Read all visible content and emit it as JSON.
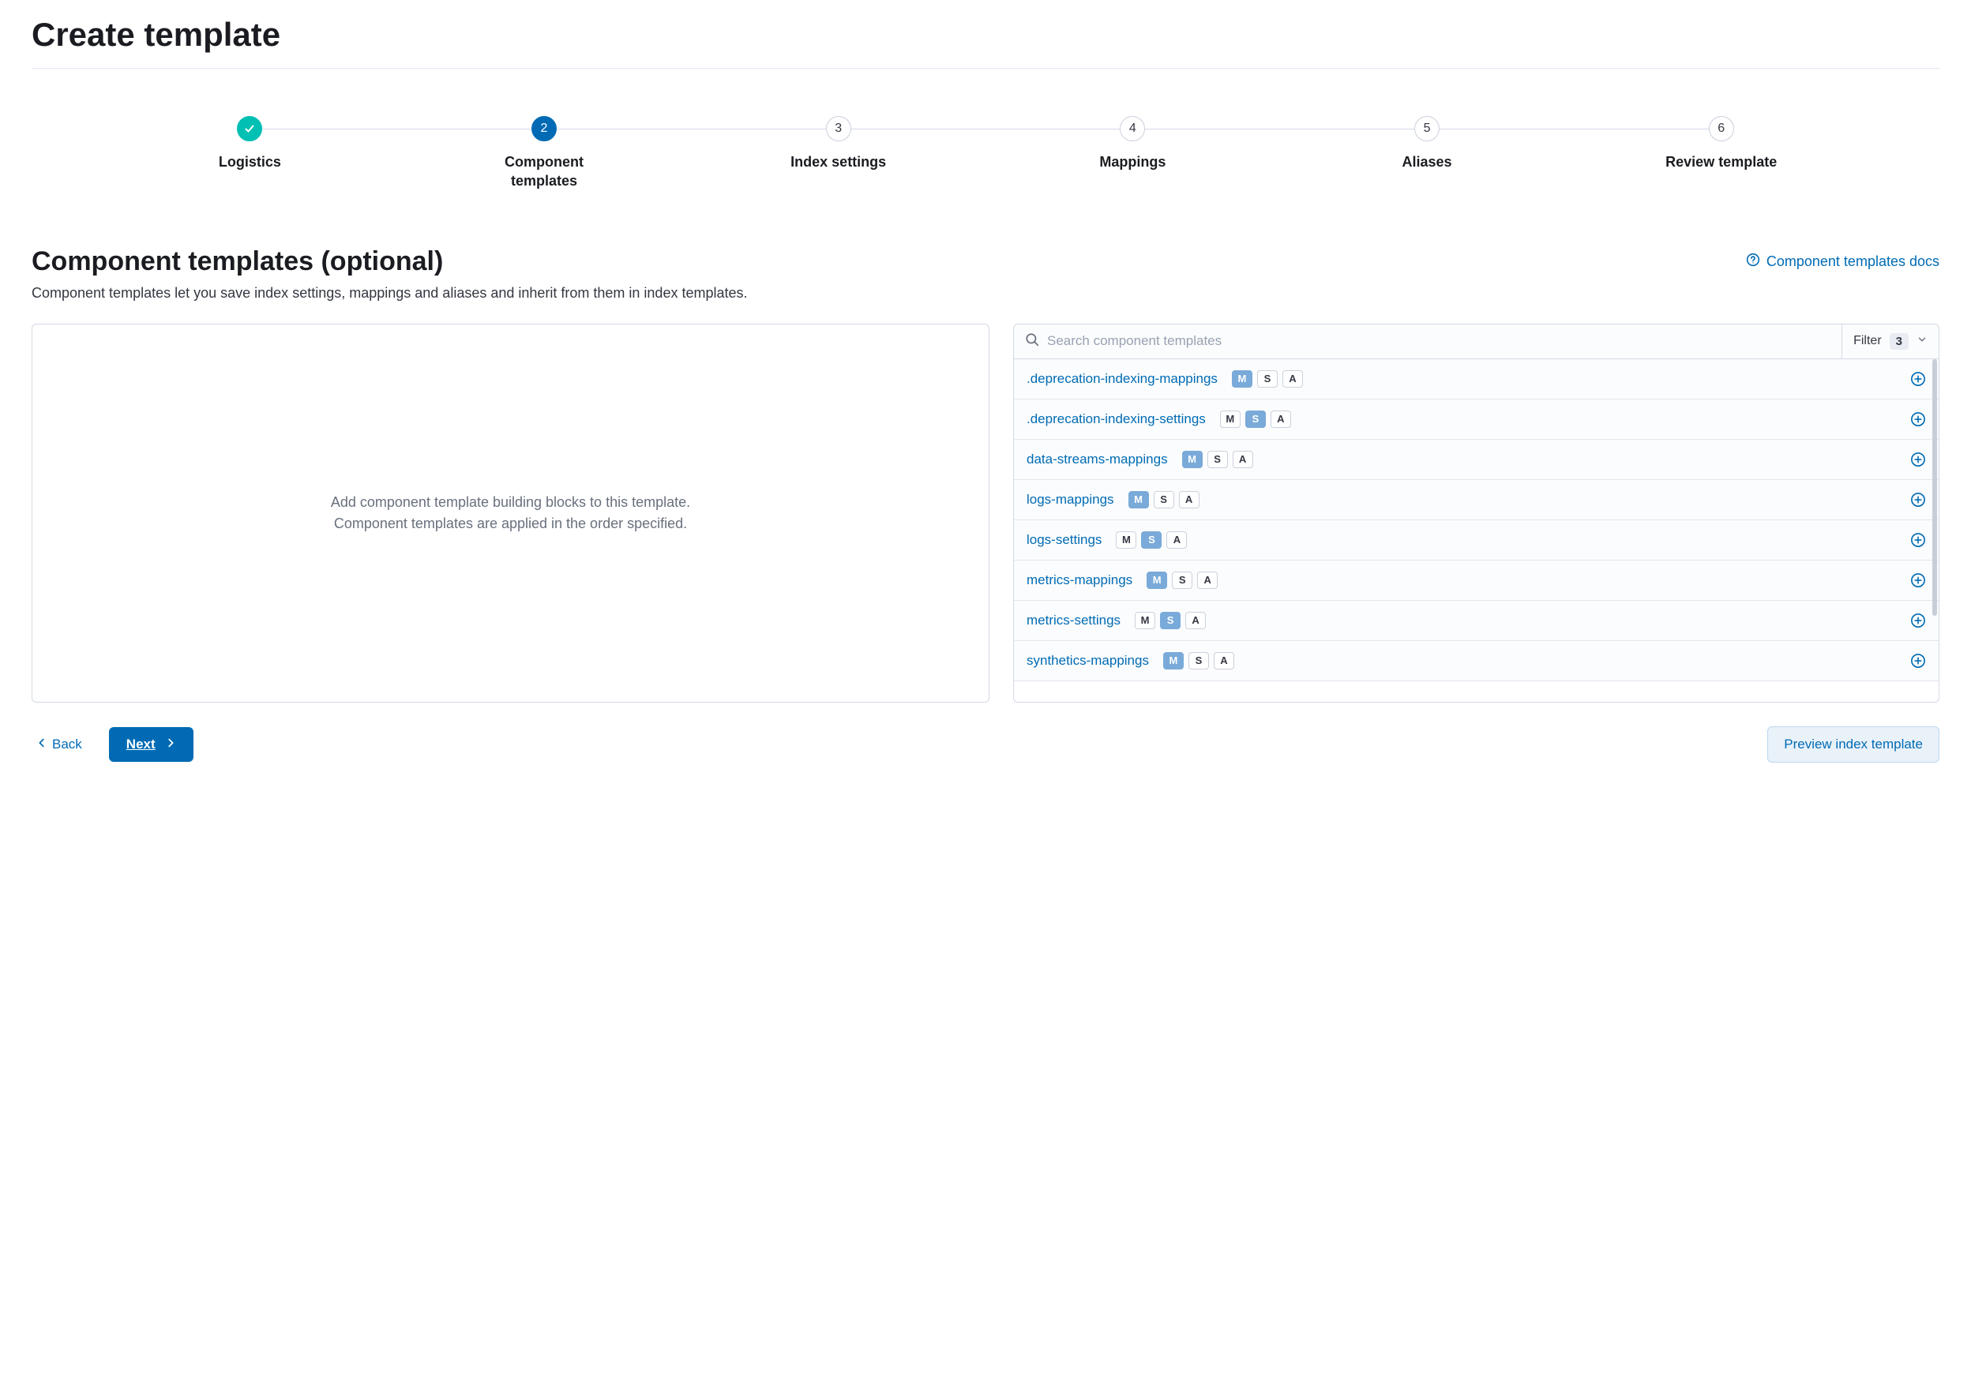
{
  "page_title": "Create template",
  "steps": [
    {
      "label": "Logistics",
      "state": "complete"
    },
    {
      "label": "Component templates",
      "state": "current",
      "num": "2"
    },
    {
      "label": "Index settings",
      "state": "pending",
      "num": "3"
    },
    {
      "label": "Mappings",
      "state": "pending",
      "num": "4"
    },
    {
      "label": "Aliases",
      "state": "pending",
      "num": "5"
    },
    {
      "label": "Review template",
      "state": "pending",
      "num": "6"
    }
  ],
  "section": {
    "title": "Component templates (optional)",
    "desc": "Component templates let you save index settings, mappings and aliases and inherit from them in index templates.",
    "docs_link": "Component templates docs"
  },
  "left_empty_text": "Add component template building blocks to this template. Component templates are applied in the order specified.",
  "search": {
    "placeholder": "Search component templates",
    "filter_label": "Filter",
    "filter_count": "3"
  },
  "badge_labels": {
    "m": "M",
    "s": "S",
    "a": "A"
  },
  "templates": [
    {
      "name": ".deprecation-indexing-mappings",
      "m": true,
      "s": false,
      "a": false
    },
    {
      "name": ".deprecation-indexing-settings",
      "m": false,
      "s": true,
      "a": false
    },
    {
      "name": "data-streams-mappings",
      "m": true,
      "s": false,
      "a": false
    },
    {
      "name": "logs-mappings",
      "m": true,
      "s": false,
      "a": false
    },
    {
      "name": "logs-settings",
      "m": false,
      "s": true,
      "a": false
    },
    {
      "name": "metrics-mappings",
      "m": true,
      "s": false,
      "a": false
    },
    {
      "name": "metrics-settings",
      "m": false,
      "s": true,
      "a": false
    },
    {
      "name": "synthetics-mappings",
      "m": true,
      "s": false,
      "a": false
    }
  ],
  "footer": {
    "back": "Back",
    "next": "Next",
    "preview": "Preview index template"
  }
}
